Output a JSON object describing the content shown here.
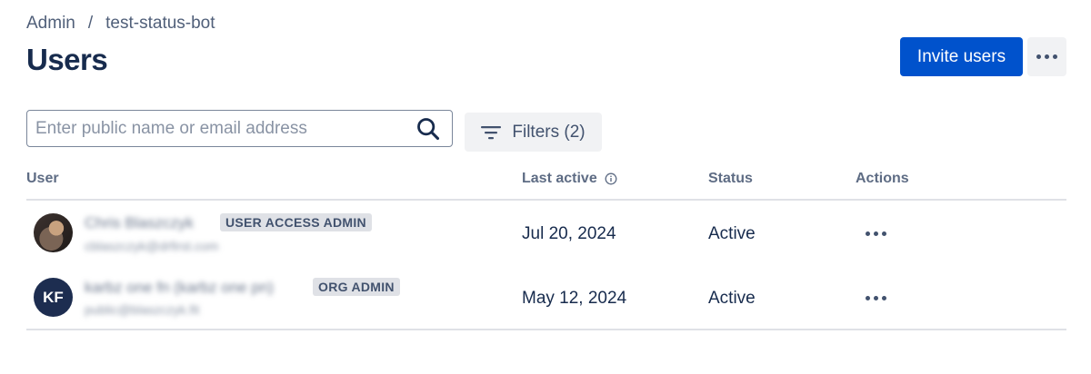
{
  "breadcrumb": {
    "root": "Admin",
    "separator": "/",
    "current": "test-status-bot"
  },
  "page": {
    "title": "Users"
  },
  "toolbar": {
    "invite_label": "Invite users",
    "more_icon": "more-horizontal-icon"
  },
  "search": {
    "value": "",
    "placeholder": "Enter public name or email address",
    "icon": "search-icon"
  },
  "filters": {
    "label": "Filters (2)",
    "icon": "filter-icon"
  },
  "table": {
    "headers": {
      "user": "User",
      "last_active": "Last active",
      "status": "Status",
      "actions": "Actions"
    },
    "rows": [
      {
        "avatar": "photo",
        "name": "Chris Blaszczyk",
        "email": "cblaszczyk@drfirst.com",
        "role": "USER ACCESS ADMIN",
        "last_active": "Jul 20, 2024",
        "status": "Active"
      },
      {
        "avatar": "KF",
        "name": "karbz one fn (karbz one pn)",
        "email": "public@blaszczyk.fit",
        "role": "ORG ADMIN",
        "last_active": "May 12, 2024",
        "status": "Active"
      }
    ]
  },
  "colors": {
    "primary": "#0052cc",
    "text": "#172b4d",
    "subtle": "#5e6c84",
    "lozenge_bg": "#dfe1e6"
  }
}
